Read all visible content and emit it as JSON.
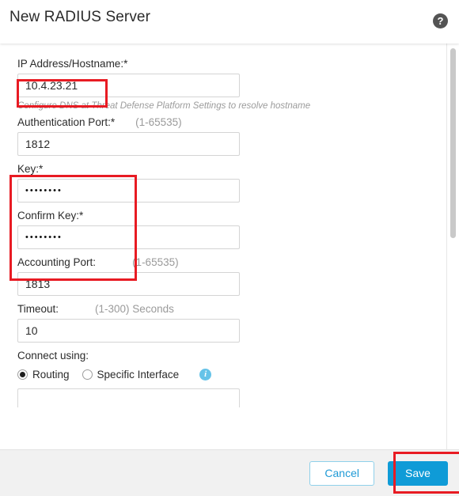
{
  "header": {
    "title": "New RADIUS Server",
    "help_icon": "help-circle-icon",
    "help_glyph": "?"
  },
  "form": {
    "ip_address": {
      "label": "IP Address/Hostname:*",
      "value": "10.4.23.21",
      "hint": "Configure DNS at Threat Defense Platform Settings to resolve hostname"
    },
    "authentication_port": {
      "label": "Authentication Port:*",
      "range": "(1-65535)",
      "value": "1812"
    },
    "key": {
      "label": "Key:*",
      "value": "••••••••"
    },
    "confirm_key": {
      "label": "Confirm Key:*",
      "value": "••••••••"
    },
    "accounting_port": {
      "label": "Accounting Port:",
      "range": "(1-65535)",
      "value": "1813"
    },
    "timeout": {
      "label": "Timeout:",
      "range": "(1-300) Seconds",
      "value": "10"
    },
    "connect_using": {
      "label": "Connect using:",
      "options": [
        {
          "label": "Routing",
          "selected": true
        },
        {
          "label": "Specific Interface",
          "selected": false
        }
      ],
      "info_icon": "info-circle-icon",
      "info_glyph": "i"
    }
  },
  "footer": {
    "cancel_label": "Cancel",
    "save_label": "Save"
  },
  "colors": {
    "accent_blue": "#0f9bd7",
    "annotation_red": "#e81b23",
    "info_blue": "#66c3e8",
    "footer_gray": "#f1f1f1"
  }
}
